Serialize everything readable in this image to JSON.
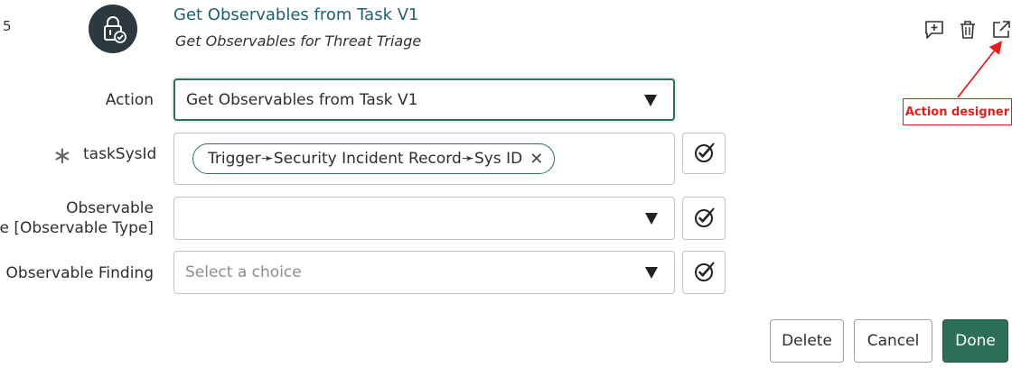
{
  "step": {
    "number": "5"
  },
  "action_header": {
    "title": "Get Observables from Task V1",
    "subtitle": "Get Observables for Threat Triage",
    "icon": "locked-action-icon"
  },
  "toolbar_icons": [
    "add-comment-icon",
    "trash-icon",
    "open-external-icon"
  ],
  "form": {
    "action": {
      "label": "Action",
      "value": "Get Observables from Task V1"
    },
    "task_sys_id": {
      "required_mark": "∗",
      "label": "taskSysId",
      "pill": "Trigger➛Security Incident Record➛Sys ID",
      "pill_remove": "✕"
    },
    "observable_type": {
      "label_line1": "Observable",
      "label_line2": "pe [Observable Type]",
      "value": ""
    },
    "observable_finding": {
      "label": "Observable Finding",
      "placeholder": "Select a choice"
    }
  },
  "buttons": {
    "delete": "Delete",
    "cancel": "Cancel",
    "done": "Done"
  },
  "annotation": {
    "text": "Action designer",
    "color": "#e02020"
  },
  "colors": {
    "accent": "#2c6e58",
    "title": "#1f5f6e",
    "icon_bg": "#2c3a40"
  }
}
